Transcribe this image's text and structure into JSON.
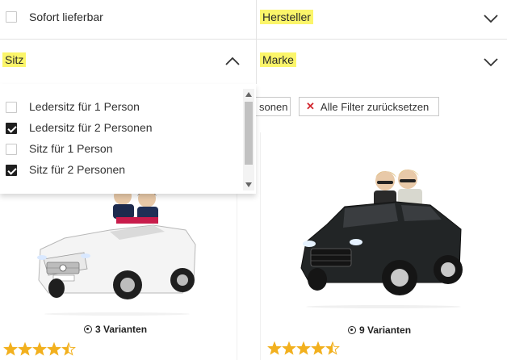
{
  "filters": {
    "sofort": {
      "label": "Sofort lieferbar",
      "checked": false
    },
    "hersteller": {
      "label": "Hersteller",
      "expanded": false
    },
    "sitz": {
      "label": "Sitz",
      "expanded": true
    },
    "marke": {
      "label": "Marke",
      "expanded": false
    }
  },
  "sitz_options": [
    {
      "label": "Ledersitz für 1 Person",
      "checked": false
    },
    {
      "label": "Ledersitz für 2 Personen",
      "checked": true
    },
    {
      "label": "Sitz für 1 Person",
      "checked": false
    },
    {
      "label": "Sitz für 2 Personen",
      "checked": true
    }
  ],
  "chips": {
    "partial_label": "sonen",
    "reset_label": "Alle Filter zurücksetzen",
    "reset_icon": "close-x-icon"
  },
  "products": [
    {
      "variants": "3 Varianten",
      "rating": 4.5,
      "color": "white"
    },
    {
      "variants": "9 Varianten",
      "rating": 4.5,
      "color": "black"
    }
  ],
  "colors": {
    "highlight": "#fbf56a",
    "reset_x": "#d2272f",
    "star": "#f2b01e"
  }
}
